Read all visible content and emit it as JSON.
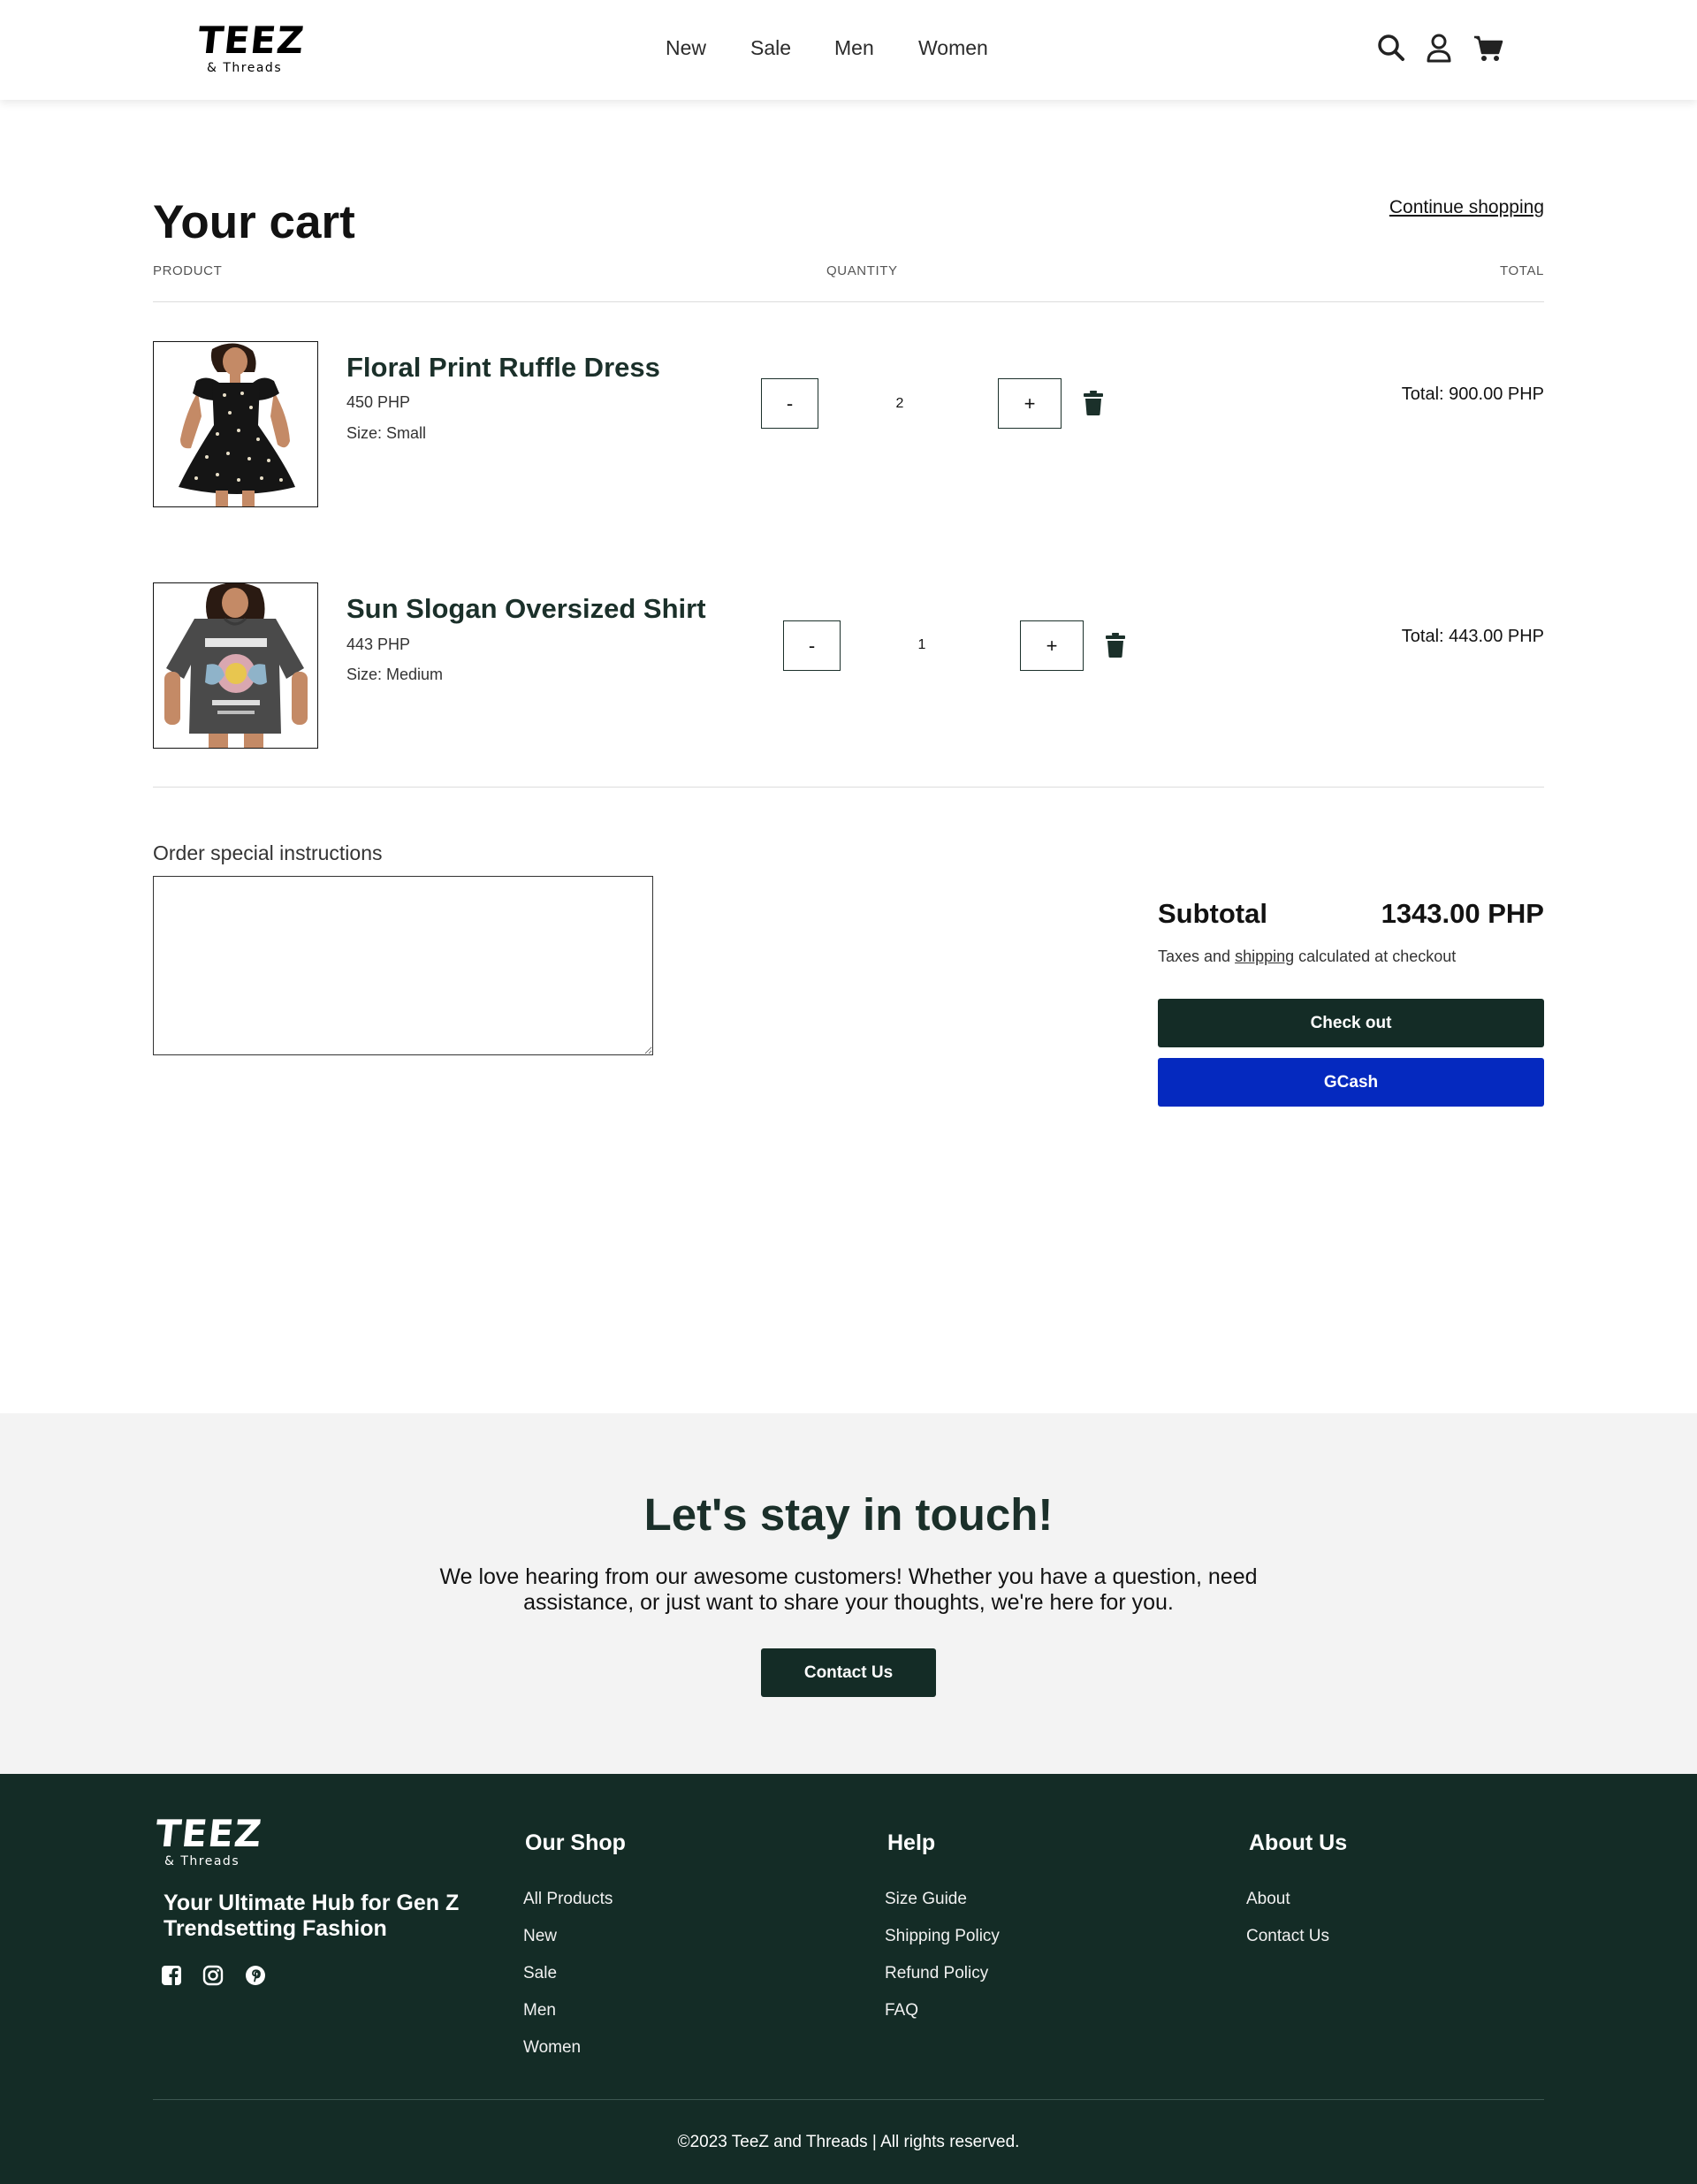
{
  "brand": {
    "name": "TEEZ",
    "sub": "& Threads"
  },
  "nav": {
    "new": "New",
    "sale": "Sale",
    "men": "Men",
    "women": "Women"
  },
  "header_icons": [
    "search-icon",
    "account-icon",
    "cart-icon"
  ],
  "cart": {
    "title": "Your cart",
    "continue_label": "Continue shopping",
    "columns": {
      "product": "PRODUCT",
      "quantity": "QUANTITY",
      "total": "TOTAL"
    },
    "items": [
      {
        "name": "Floral Print Ruffle Dress",
        "price": "450 PHP",
        "size": "Size: Small",
        "qty": "2",
        "minus": "-",
        "plus": "+",
        "total": "Total: 900.00 PHP"
      },
      {
        "name": "Sun Slogan Oversized Shirt",
        "price": "443 PHP",
        "size": "Size: Medium",
        "qty": "1",
        "minus": "-",
        "plus": "+",
        "total": "Total: 443.00 PHP"
      }
    ],
    "instructions_label": "Order special instructions",
    "subtotal_label": "Subtotal",
    "subtotal_value": "1343.00 PHP",
    "tax_prefix": "Taxes and ",
    "tax_link": "shipping",
    "tax_suffix": " calculated at checkout",
    "checkout_label": "Check out",
    "gcash_label": "GCash"
  },
  "contact": {
    "title": "Let's stay in touch!",
    "text": "We love hearing from our awesome customers! Whether you have a question, need assistance, or just want to share your thoughts, we're here for you.",
    "button": "Contact Us"
  },
  "footer": {
    "tagline": "Your Ultimate Hub for Gen Z Trendsetting Fashion",
    "social": [
      "facebook-icon",
      "instagram-icon",
      "pinterest-icon"
    ],
    "shop": {
      "heading": "Our Shop",
      "links": [
        "All Products",
        "New",
        "Sale",
        "Men",
        "Women"
      ]
    },
    "help": {
      "heading": "Help",
      "links": [
        "Size Guide",
        "Shipping Policy",
        "Refund Policy",
        "FAQ"
      ]
    },
    "about": {
      "heading": "About Us",
      "links": [
        "About",
        "Contact Us"
      ]
    },
    "copyright": "©2023 TeeZ and Threads | All rights reserved."
  },
  "colors": {
    "dark_green": "#142c26",
    "heading_green": "#1b302a",
    "gcash_blue": "#0529bf",
    "contact_bg": "#f3f3f3"
  }
}
